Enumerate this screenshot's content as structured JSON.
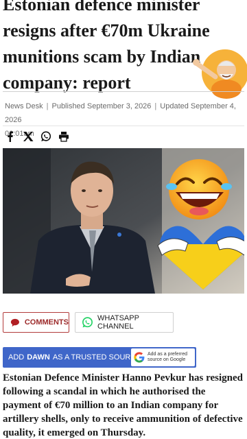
{
  "headline": {
    "lines": [
      "Estonian defence minister",
      "resigns after €70m Ukraine",
      "munitions scam by Indian",
      "company: report"
    ]
  },
  "byline": {
    "author": "News Desk",
    "published": "Published September 3, 2026",
    "updated": "Updated September 4, 2026",
    "time": "01:01am"
  },
  "share": {
    "icons": [
      "facebook-icon",
      "x-icon",
      "whatsapp-icon",
      "print-icon"
    ]
  },
  "actions": {
    "comments_label": "COMMENTS",
    "whatsapp_label": "WHATSAPP CHANNEL"
  },
  "trusted": {
    "prefix": "ADD",
    "brand": "DAWN",
    "suffix": "AS A TRUSTED SOURCE",
    "google_line1": "Add as a preferred",
    "google_line2": "source on Google"
  },
  "article": {
    "lead": "Estonian Defence Minister Hanno Pevkur has resigned following a scandal in which he authorised the payment of €70 million to an Indian company for artillery shells, only to receive ammunition of defective quality, it emerged on Thursday."
  },
  "colors": {
    "trusted_bar": "#3f66c9",
    "comments_accent": "#9c2a2a",
    "whatsapp_green": "#25d366"
  }
}
